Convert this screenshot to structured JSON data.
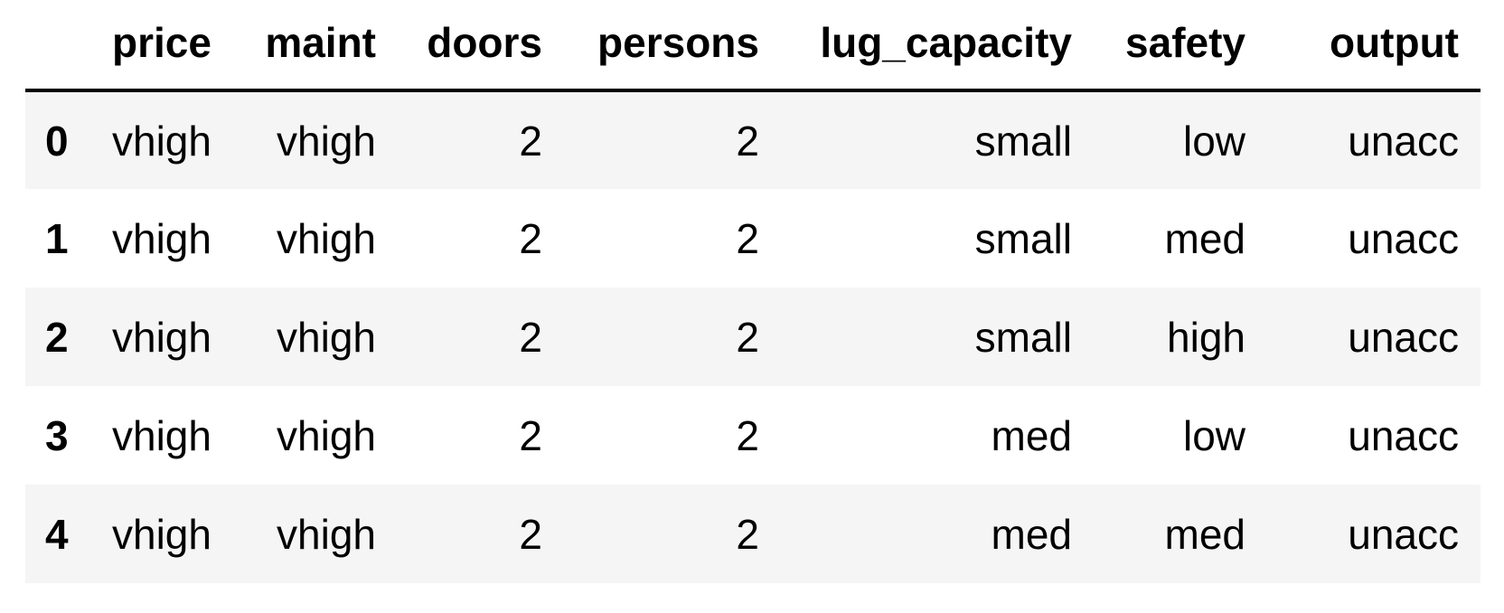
{
  "table": {
    "columns": [
      "price",
      "maint",
      "doors",
      "persons",
      "lug_capacity",
      "safety",
      "output"
    ],
    "rows": [
      {
        "index": "0",
        "cells": [
          "vhigh",
          "vhigh",
          "2",
          "2",
          "small",
          "low",
          "unacc"
        ]
      },
      {
        "index": "1",
        "cells": [
          "vhigh",
          "vhigh",
          "2",
          "2",
          "small",
          "med",
          "unacc"
        ]
      },
      {
        "index": "2",
        "cells": [
          "vhigh",
          "vhigh",
          "2",
          "2",
          "small",
          "high",
          "unacc"
        ]
      },
      {
        "index": "3",
        "cells": [
          "vhigh",
          "vhigh",
          "2",
          "2",
          "med",
          "low",
          "unacc"
        ]
      },
      {
        "index": "4",
        "cells": [
          "vhigh",
          "vhigh",
          "2",
          "2",
          "med",
          "med",
          "unacc"
        ]
      }
    ]
  },
  "colors": {
    "stripe": "#f5f5f5",
    "background": "#ffffff",
    "text": "#000000",
    "header_rule": "#000000"
  }
}
